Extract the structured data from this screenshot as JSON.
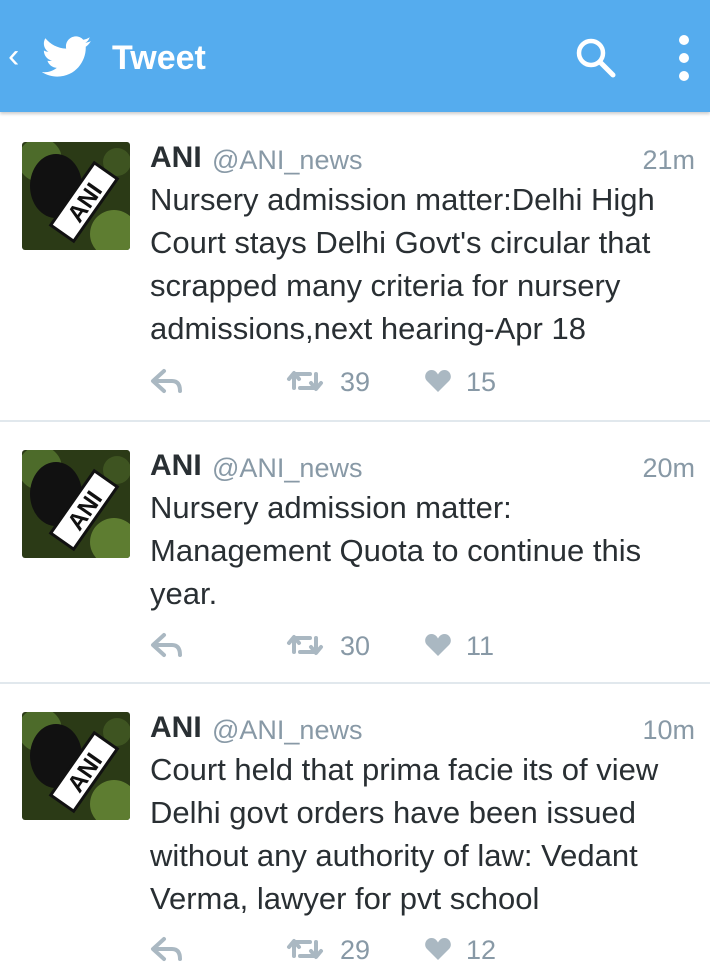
{
  "header": {
    "title": "Tweet",
    "back_icon": "back-chevron-icon",
    "logo_icon": "twitter-bird-icon",
    "search_icon": "search-icon",
    "menu_icon": "more-vertical-icon",
    "bar_color": "#55acee"
  },
  "tweets": [
    {
      "name": "ANI",
      "handle": "@ANI_news",
      "time": "21m",
      "text": "Nursery admission matter:Delhi High\nCourt stays Delhi Govt's circular that\nscrapped many criteria for nursery\nadmissions,next hearing-Apr 18",
      "retweets": "39",
      "likes": "15",
      "avatar_text": "ANI"
    },
    {
      "name": "ANI",
      "handle": "@ANI_news",
      "time": "20m",
      "text": "Nursery admission matter:\nManagement Quota to continue this\nyear.",
      "retweets": "30",
      "likes": "11",
      "avatar_text": "ANI"
    },
    {
      "name": "ANI",
      "handle": "@ANI_news",
      "time": "10m",
      "text": "Court held that prima facie its of view\nDelhi govt orders have been issued\nwithout any authority of law: Vedant\nVerma, lawyer for pvt school",
      "retweets": "29",
      "likes": "12",
      "avatar_text": "ANI"
    }
  ]
}
